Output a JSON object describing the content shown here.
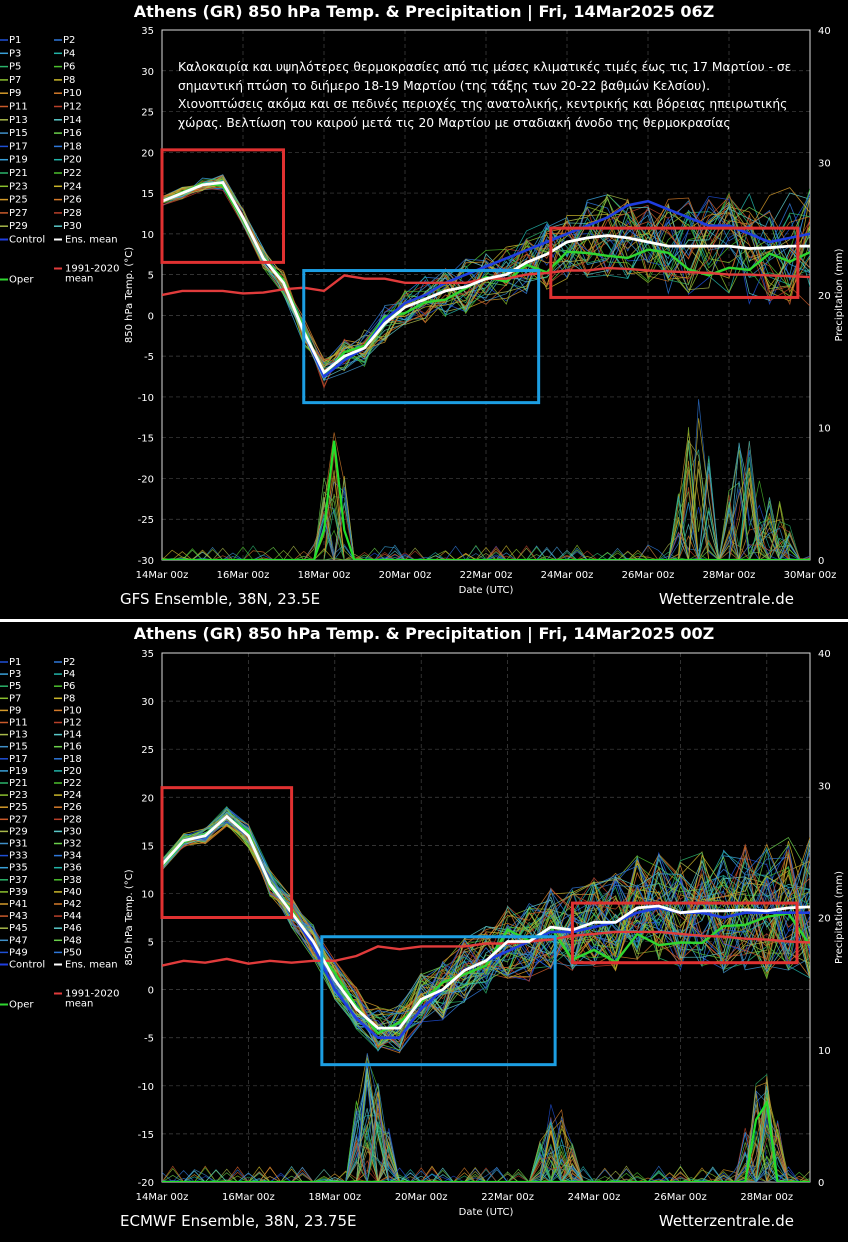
{
  "chart_data": [
    {
      "type": "line",
      "title": "Athens  (GR)  850 hPa Temp. & Precipitation | Fri, 14Mar2025 06Z",
      "model": "GFS Ensemble, 38N, 23.5E",
      "source": "Wetterzentrale.de",
      "annotation": "Καλοκαιρία και υψηλότερες θερμοκρασίες από τις μέσες κλιματικές τιμές έως τις 17 Μαρτίου - σε σημαντική πτώση το διήμερο 18-19 Μαρτίου  (της τάξης των 20-22 βαθμών Κελσίου). Χιονοπτώσεις ακόμα και σε πεδινές περιοχές της ανατολικής, κεντρικής και βόρειας ηπειρωτικής χώρας. Βελτίωση του καιρού μετά τις 20 Μαρτίου με σταδιακή άνοδο της θερμοκρασίας",
      "xlabel": "Date (UTC)",
      "ylabel": "850 hPa Temp. (°C)",
      "y2label": "Precipitation (mm)",
      "ylim": [
        -30,
        35
      ],
      "y2lim": [
        0,
        40
      ],
      "yticks": [
        "35",
        "30",
        "25",
        "20",
        "15",
        "10",
        "5",
        "0",
        "-5",
        "-10",
        "-15",
        "-20",
        "-25",
        "-30"
      ],
      "y2ticks": [
        "40",
        "30",
        "20",
        "10",
        "0"
      ],
      "xticks": [
        "14Mar 00z",
        "16Mar 00z",
        "18Mar 00z",
        "20Mar 00z",
        "22Mar 00z",
        "24Mar 00z",
        "26Mar 00z",
        "28Mar 00z",
        "30Mar 00z"
      ],
      "legend": [
        "P1",
        "P2",
        "P3",
        "P4",
        "P5",
        "P6",
        "P7",
        "P8",
        "P9",
        "P10",
        "P11",
        "P12",
        "P13",
        "P14",
        "P15",
        "P16",
        "P17",
        "P18",
        "P19",
        "P20",
        "P21",
        "P22",
        "P23",
        "P24",
        "P25",
        "P26",
        "P27",
        "P28",
        "P29",
        "P30"
      ],
      "legend_control": "Control",
      "legend_mean": "Ens. mean",
      "legend_oper": "Oper",
      "legend_clim": [
        "1991-2020",
        "mean"
      ],
      "members": 30,
      "days": 16,
      "x": [
        0,
        0.5,
        1,
        1.5,
        2,
        2.5,
        3,
        3.5,
        4,
        4.5,
        5,
        5.5,
        6,
        6.5,
        7,
        7.5,
        8,
        8.5,
        9,
        9.5,
        10,
        10.5,
        11,
        11.5,
        12,
        12.5,
        13,
        13.5,
        14,
        14.5,
        15,
        15.5,
        16
      ],
      "series": [
        {
          "name": "Ens. mean",
          "values": [
            14,
            15,
            16,
            16.3,
            12,
            7,
            4,
            -2,
            -7,
            -5,
            -4,
            -1,
            1,
            2,
            3,
            3.5,
            4.5,
            5,
            6.5,
            7.5,
            9,
            9.5,
            9.8,
            9.5,
            9,
            8.5,
            8.5,
            8.5,
            8.5,
            8.2,
            8.3,
            8.5,
            8.5
          ]
        },
        {
          "name": "Control",
          "values": [
            14,
            15,
            16,
            16.3,
            12,
            7,
            4,
            -2,
            -7.5,
            -5.5,
            -4,
            -0.5,
            1.5,
            2.5,
            4,
            5,
            6,
            7,
            8,
            9,
            10,
            11,
            12,
            13.5,
            14,
            13,
            12,
            11,
            11,
            10,
            9,
            9.5,
            10
          ]
        },
        {
          "name": "1991-2020 mean",
          "values": [
            2.5,
            3,
            3,
            3,
            2.7,
            2.8,
            3.2,
            3.4,
            3,
            4.9,
            4.5,
            4.5,
            4,
            4,
            4,
            4,
            4.5,
            4.5,
            5,
            5.2,
            5.5,
            5.5,
            5.8,
            5.7,
            5.5,
            5.4,
            5.3,
            5.2,
            5,
            5,
            4.9,
            4.8,
            4.7
          ]
        }
      ],
      "precip_spikes": [
        {
          "x": 4.25,
          "max_mm": 10
        },
        {
          "x": 13.2,
          "max_mm": 14
        },
        {
          "x": 14.4,
          "max_mm": 12
        },
        {
          "x": 15.1,
          "max_mm": 6
        }
      ],
      "boxes": [
        {
          "color": "#e03131",
          "x": [
            0,
            3
          ],
          "y": [
            6.5,
            20.3
          ]
        },
        {
          "color": "#1c9ee2",
          "x": [
            3.5,
            9.3
          ],
          "y": [
            -10.7,
            5.5
          ]
        },
        {
          "color": "#e03131",
          "x": [
            9.6,
            15.7
          ],
          "y": [
            2.2,
            10.7
          ]
        }
      ],
      "grid": true
    },
    {
      "type": "line",
      "title": "Athens  (GR)  850 hPa Temp. & Precipitation | Fri, 14Mar2025 00Z",
      "model": "ECMWF Ensemble, 38N, 23.75E",
      "source": "Wetterzentrale.de",
      "xlabel": "Date (UTC)",
      "ylabel": "850 hPa Temp. (°C)",
      "y2label": "Precipitation (mm)",
      "ylim": [
        -20,
        35
      ],
      "y2lim": [
        0,
        40
      ],
      "yticks": [
        "35",
        "30",
        "25",
        "20",
        "15",
        "10",
        "5",
        "0",
        "-5",
        "-10",
        "-15",
        "-20"
      ],
      "y2ticks": [
        "40",
        "30",
        "20",
        "10",
        "0"
      ],
      "xticks": [
        "14Mar 00z",
        "16Mar 00z",
        "18Mar 00z",
        "20Mar 00z",
        "22Mar 00z",
        "24Mar 00z",
        "26Mar 00z",
        "28Mar 00z"
      ],
      "legend": [
        "P1",
        "P2",
        "P3",
        "P4",
        "P5",
        "P6",
        "P7",
        "P8",
        "P9",
        "P10",
        "P11",
        "P12",
        "P13",
        "P14",
        "P15",
        "P16",
        "P17",
        "P18",
        "P19",
        "P20",
        "P21",
        "P22",
        "P23",
        "P24",
        "P25",
        "P26",
        "P27",
        "P28",
        "P29",
        "P30",
        "P31",
        "P32",
        "P33",
        "P34",
        "P35",
        "P36",
        "P37",
        "P38",
        "P39",
        "P40",
        "P41",
        "P42",
        "P43",
        "P44",
        "P45",
        "P46",
        "P47",
        "P48",
        "P49",
        "P50"
      ],
      "legend_control": "Control",
      "legend_mean": "Ens. mean",
      "legend_oper": "Oper",
      "legend_clim": [
        "1991-2020",
        "mean"
      ],
      "members": 50,
      "days": 15,
      "x": [
        0,
        0.5,
        1,
        1.5,
        2,
        2.5,
        3,
        3.5,
        4,
        4.5,
        5,
        5.5,
        6,
        6.5,
        7,
        7.5,
        8,
        8.5,
        9,
        9.5,
        10,
        10.5,
        11,
        11.5,
        12,
        12.5,
        13,
        13.5,
        14,
        14.5,
        15
      ],
      "series": [
        {
          "name": "Ens. mean",
          "values": [
            13,
            15.5,
            16,
            18,
            16,
            11,
            8,
            5,
            1,
            -2,
            -4,
            -4,
            -1,
            0,
            2,
            3,
            5,
            5,
            6.5,
            6.2,
            7,
            7,
            8.5,
            8.7,
            8,
            8.2,
            8.2,
            8.3,
            8.2,
            8.5,
            8.6
          ]
        },
        {
          "name": "Control",
          "values": [
            13,
            15.5,
            16,
            18,
            16,
            11,
            8,
            4.5,
            0,
            -3,
            -5,
            -5,
            -2,
            0,
            2,
            3,
            4,
            5,
            6,
            6,
            6.5,
            7,
            8,
            8.5,
            8,
            8,
            7.5,
            8,
            8,
            8,
            8
          ]
        },
        {
          "name": "1991-2020 mean",
          "values": [
            2.5,
            3,
            2.8,
            3.2,
            2.7,
            3,
            2.8,
            3,
            3,
            3.5,
            4.5,
            4.2,
            4.5,
            4.5,
            4.5,
            4.8,
            4.8,
            5,
            5.2,
            5.6,
            5.8,
            6,
            6,
            6,
            5.8,
            5.6,
            5.5,
            5.3,
            5.2,
            5,
            4.9
          ]
        }
      ],
      "precip_spikes": [
        {
          "x": 4.8,
          "max_mm": 11
        },
        {
          "x": 9.1,
          "max_mm": 7
        },
        {
          "x": 13.9,
          "max_mm": 9.5
        }
      ],
      "boxes": [
        {
          "color": "#e03131",
          "x": [
            0,
            3.0
          ],
          "y": [
            7.5,
            21
          ]
        },
        {
          "color": "#1c9ee2",
          "x": [
            3.7,
            9.1
          ],
          "y": [
            -7.8,
            5.5
          ]
        },
        {
          "color": "#e03131",
          "x": [
            9.5,
            14.7
          ],
          "y": [
            2.8,
            9
          ]
        }
      ],
      "grid": true
    }
  ]
}
